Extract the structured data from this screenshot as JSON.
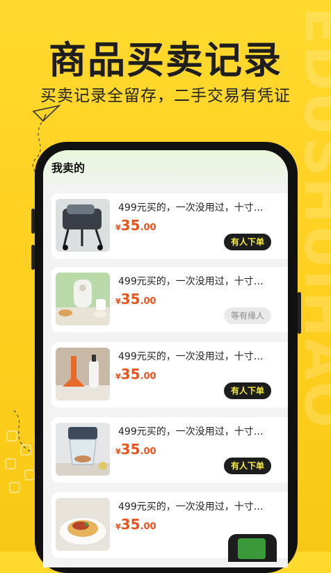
{
  "headline": "商品买卖记录",
  "subheadline": "买卖记录全留存，二手交易有凭证",
  "background_text": "EDUSHUIHAO",
  "colors": {
    "background": "#ffd42a",
    "price": "#e8541d",
    "tag_active_bg": "#1d1d1d",
    "tag_active_text": "#f5ea3a",
    "tag_waiting_bg": "#e9e9e9"
  },
  "screen": {
    "title": "我卖的",
    "items": [
      {
        "thumb_icon": "stroller-photo",
        "desc": "499元买的，一次没用过，十寸…",
        "price_symbol": "¥",
        "price_int": "35",
        "price_dec": ".00",
        "tag": "有人下单",
        "tag_state": "active"
      },
      {
        "thumb_icon": "food-processor-photo",
        "desc": "499元买的，一次没用过，十寸…",
        "price_symbol": "¥",
        "price_int": "35",
        "price_dec": ".00",
        "tag": "等有缘人",
        "tag_state": "waiting"
      },
      {
        "thumb_icon": "kitchen-tools-photo",
        "desc": "499元买的，一次没用过，十寸…",
        "price_symbol": "¥",
        "price_int": "35",
        "price_dec": ".00",
        "tag": "有人下单",
        "tag_state": "active"
      },
      {
        "thumb_icon": "blender-photo",
        "desc": "499元买的，一次没用过，十寸…",
        "price_symbol": "¥",
        "price_int": "35",
        "price_dec": ".00",
        "tag": "有人下单",
        "tag_state": "active"
      },
      {
        "thumb_icon": "noodles-photo",
        "desc": "499元买的，一次没用过，十寸…",
        "price_symbol": "¥",
        "price_int": "35",
        "price_dec": ".00",
        "tag": "",
        "tag_state": "hidden"
      }
    ]
  }
}
